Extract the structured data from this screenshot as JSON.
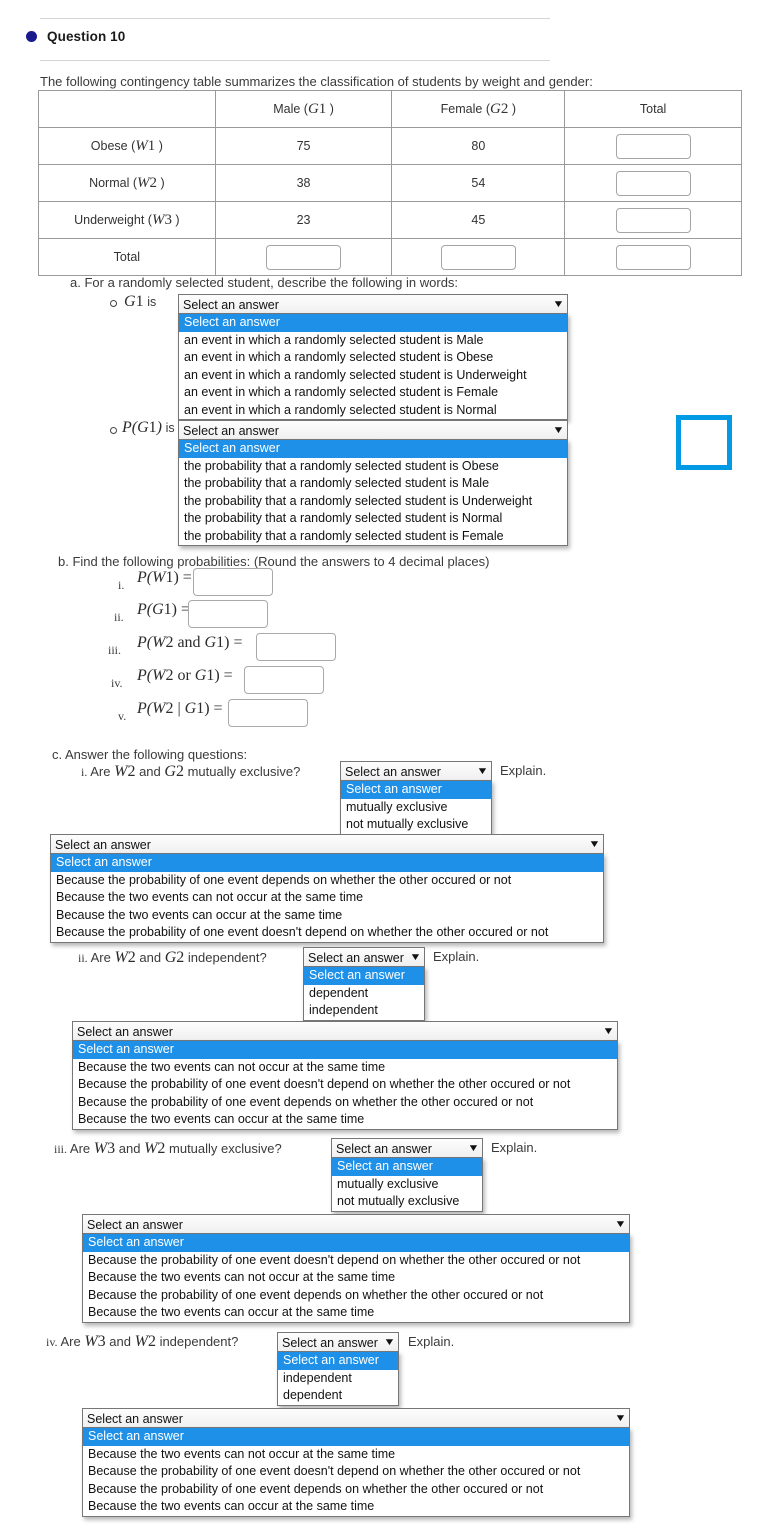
{
  "header": {
    "title": "Question 10",
    "bullet": "filled-circle-bullet"
  },
  "intro": "The following contingency table summarizes the classification of students by weight and gender:",
  "table": {
    "columns": [
      "",
      "Male (G1 )",
      "Female (G2 )",
      "Total"
    ],
    "col_labels": [
      {
        "text": "",
        "var": "",
        "sub": ""
      },
      {
        "prefix": "Male (",
        "var": "G",
        "sub": "1",
        "suffix": " )"
      },
      {
        "prefix": "Female (",
        "var": "G",
        "sub": "2",
        "suffix": " )"
      },
      {
        "prefix": "Total",
        "var": "",
        "sub": "",
        "suffix": ""
      }
    ],
    "rows": [
      {
        "label_prefix": "Obese (",
        "var": "W",
        "sub": "1",
        "label_suffix": " )",
        "male": "75",
        "female": "80",
        "total": ""
      },
      {
        "label_prefix": "Normal (",
        "var": "W",
        "sub": "2",
        "label_suffix": " )",
        "male": "38",
        "female": "54",
        "total": ""
      },
      {
        "label_prefix": "Underweight (",
        "var": "W",
        "sub": "3",
        "label_suffix": " )",
        "male": "23",
        "female": "45",
        "total": ""
      },
      {
        "label_prefix": "Total",
        "var": "",
        "sub": "",
        "label_suffix": "",
        "male": "",
        "female": "",
        "total": ""
      }
    ]
  },
  "part_a": {
    "heading": "a. For a randomly selected student, describe the following in words:",
    "item1": {
      "marker": "",
      "expr_var": "G",
      "expr_sub": "1",
      "connector": "is",
      "select_value": "Select an answer",
      "options": [
        "Select an answer",
        "an event in which a randomly selected student is Male",
        "an event in which a randomly selected student is Obese",
        "an event in which a randomly selected student is Underweight",
        "an event in which a randomly selected student is Female",
        "an event in which a randomly selected student is Normal"
      ]
    },
    "item2": {
      "expr_pre": "P(",
      "expr_var": "G",
      "expr_sub": "1",
      "expr_post": ")",
      "connector": "is",
      "select_value": "Select an answer",
      "options": [
        "Select an answer",
        "the probability that a randomly selected student is Obese",
        "the probability that a randomly selected student is Male",
        "the probability that a randomly selected student is Underweight",
        "the probability that a randomly selected student is Normal",
        "the probability that a randomly selected student is Female"
      ]
    }
  },
  "part_b": {
    "heading": "b. Find the following probabilities: (Round the answers to 4 decimal places)",
    "items": [
      {
        "num": "i.",
        "pre": "P(",
        "v1": "W",
        "s1": "1",
        "mid": "",
        "v2": "",
        "s2": "",
        "post": ") =",
        "value": ""
      },
      {
        "num": "ii.",
        "pre": "P(",
        "v1": "G",
        "s1": "1",
        "mid": "",
        "v2": "",
        "s2": "",
        "post": ") =",
        "value": ""
      },
      {
        "num": "iii.",
        "pre": "P(",
        "v1": "W",
        "s1": "2",
        "mid": " and ",
        "v2": "G",
        "s2": "1",
        "post": ") =",
        "value": ""
      },
      {
        "num": "iv.",
        "pre": "P(",
        "v1": "W",
        "s1": "2",
        "mid": " or ",
        "v2": "G",
        "s2": "1",
        "post": ") =",
        "value": ""
      },
      {
        "num": "v.",
        "pre": "P(",
        "v1": "W",
        "s1": "2",
        "mid": " | ",
        "v2": "G",
        "s2": "1",
        "post": ") =",
        "value": ""
      }
    ]
  },
  "part_c": {
    "heading": "c. Answer the following questions:",
    "q1": {
      "num": "i.",
      "lead": "Are",
      "v1": "W",
      "s1": "2",
      "conj": "and",
      "v2": "G",
      "s2": "2",
      "tail": "mutually exclusive?",
      "explain": "Explain.",
      "select_value": "Select an answer",
      "options": [
        "Select an answer",
        "mutually exclusive",
        "not mutually exclusive"
      ],
      "reason_value": "Select an answer",
      "reason_options": [
        "Select an answer",
        "Because the probability of one event depends on whether the other occured or not",
        "Because the two events can not occur at the same time",
        "Because the two events can occur at the same time",
        "Because the probability of one event doesn't depend on whether the other occured or not"
      ]
    },
    "q2": {
      "num": "ii.",
      "lead": "Are",
      "v1": "W",
      "s1": "2",
      "conj": "and",
      "v2": "G",
      "s2": "2",
      "tail": "independent?",
      "explain": "Explain.",
      "select_value": "Select an answer",
      "options": [
        "Select an answer",
        "dependent",
        "independent"
      ],
      "reason_value": "Select an answer",
      "reason_options": [
        "Select an answer",
        "Because the two events can not occur at the same time",
        "Because the probability of one event doesn't depend on whether the other occured or not",
        "Because the probability of one event depends on whether the other occured or not",
        "Because the two events can occur at the same time"
      ]
    },
    "q3": {
      "num": "iii.",
      "lead": "Are",
      "v1": "W",
      "s1": "3",
      "conj": "and",
      "v2": "W",
      "s2": "2",
      "tail": "mutually exclusive?",
      "explain": "Explain.",
      "select_value": "Select an answer",
      "options": [
        "Select an answer",
        "mutually exclusive",
        "not mutually exclusive"
      ],
      "reason_value": "Select an answer",
      "reason_options": [
        "Select an answer",
        "Because the probability of one event doesn't depend on whether the other occured or not",
        "Because the two events can not occur at the same time",
        "Because the probability of one event depends on whether the other occured or not",
        "Because the two events can occur at the same time"
      ]
    },
    "q4": {
      "num": "iv.",
      "lead": "Are",
      "v1": "W",
      "s1": "3",
      "conj": "and",
      "v2": "W",
      "s2": "2",
      "tail": "independent?",
      "explain": "Explain.",
      "select_value": "Select an answer",
      "options": [
        "Select an answer",
        "independent",
        "dependent"
      ],
      "reason_value": "Select an answer",
      "reason_options": [
        "Select an answer",
        "Because the two events can not occur at the same time",
        "Because the probability of one event doesn't depend on whether the other occured or not",
        "Because the probability of one event depends on whether the other occured or not",
        "Because the two events can occur at the same time"
      ]
    }
  },
  "colors": {
    "highlight_blue": "#1e90e8",
    "focus_square": "#029ae4",
    "bullet_navy": "#1a1a8c"
  }
}
